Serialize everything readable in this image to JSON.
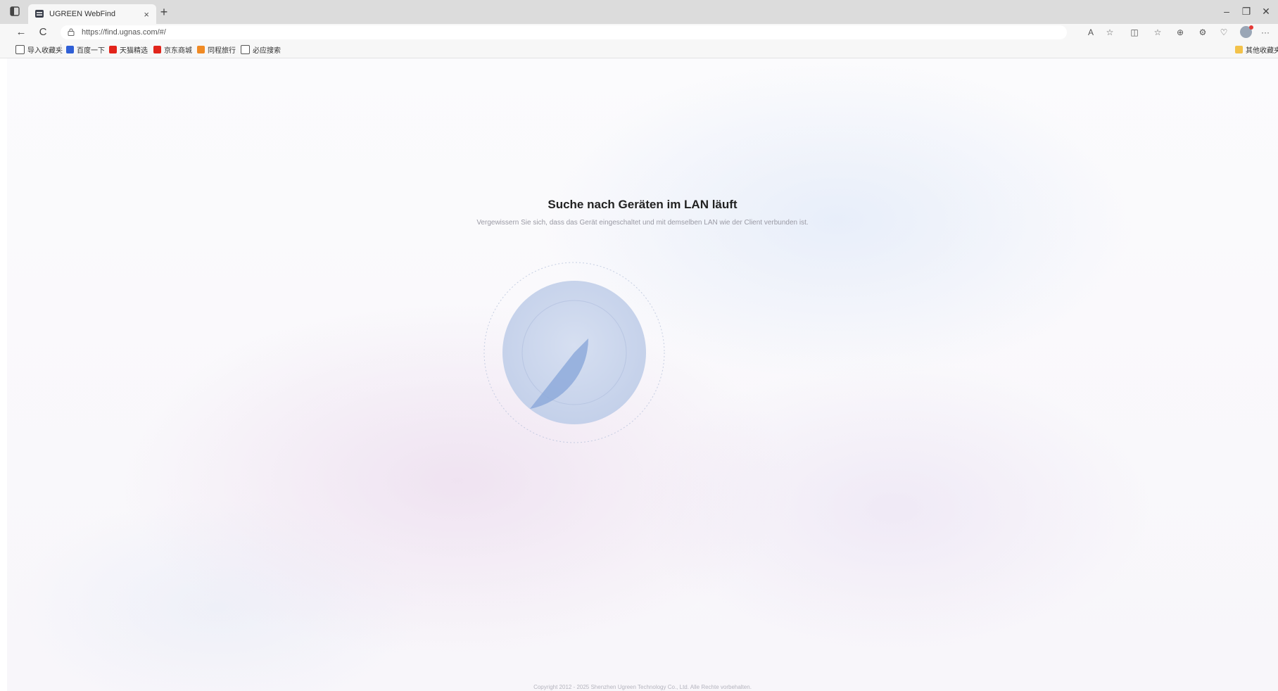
{
  "browser": {
    "tab_title": "UGREEN WebFind",
    "tab_close": "×",
    "new_tab": "+",
    "url": "https://find.ugnas.com/#/",
    "window_controls": {
      "minimize": "–",
      "restore": "❐",
      "close": "✕"
    },
    "nav": {
      "back": "←",
      "reload": "C"
    },
    "toolbar_icons": [
      "read-aloud-icon",
      "favorite-star-icon",
      "split-screen-icon",
      "favorites-icon",
      "collections-icon",
      "extensions-icon",
      "browser-essentials-icon",
      "profile-avatar",
      "more-menu-icon"
    ],
    "toolbar_glyphs": {
      "read_aloud": "A",
      "favorite": "☆",
      "split": "◫",
      "favorites": "☆",
      "collections": "⊕",
      "extensions": "⚙",
      "essentials": "♡",
      "more": "···"
    }
  },
  "bookmarks": [
    {
      "label": "导入收藏夹",
      "color": "#ffffff",
      "icon": "folder-icon"
    },
    {
      "label": "百度一下",
      "color": "#2f5fd6",
      "icon": "baidu-icon"
    },
    {
      "label": "天猫精选",
      "color": "#e2231a",
      "icon": "tmall-icon"
    },
    {
      "label": "京东商城",
      "color": "#e1251b",
      "icon": "jd-icon"
    },
    {
      "label": "同程旅行",
      "color": "#f08a24",
      "icon": "tongcheng-icon"
    },
    {
      "label": "必应搜索",
      "color": "#ffffff",
      "icon": "page-icon"
    }
  ],
  "bookmarks_other": "其他收藏夹",
  "page": {
    "title": "Suche nach Geräten im LAN läuft",
    "subtitle": "Vergewissern Sie sich, dass das Gerät eingeschaltet und mit demselben LAN wie der Client verbunden ist.",
    "copyright": "Copyright 2012 - 2025 Shenzhen Ugreen Technology Co., Ltd. Alle Rechte vorbehalten."
  },
  "colors": {
    "radar_fill": "#c5d2ec",
    "radar_sweep": "#8eaadb",
    "radar_ring": "#b9c4dc"
  }
}
